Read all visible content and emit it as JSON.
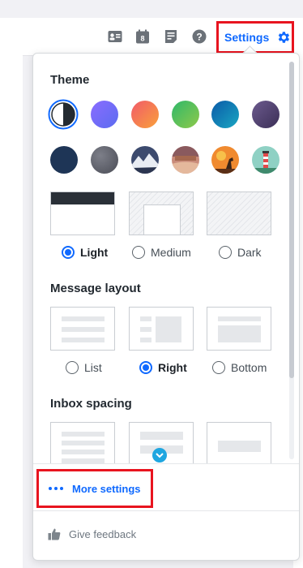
{
  "toolbar": {
    "icons": [
      "contacts-icon",
      "calendar-icon",
      "notepad-icon",
      "help-icon"
    ],
    "calendar_day": "8",
    "settings_label": "Settings"
  },
  "theme": {
    "title": "Theme",
    "options": [
      {
        "label": "Light",
        "checked": true
      },
      {
        "label": "Medium",
        "checked": false
      },
      {
        "label": "Dark",
        "checked": false
      }
    ]
  },
  "message_layout": {
    "title": "Message layout",
    "options": [
      {
        "label": "List",
        "checked": false
      },
      {
        "label": "Right",
        "checked": true
      },
      {
        "label": "Bottom",
        "checked": false
      }
    ]
  },
  "inbox_spacing": {
    "title": "Inbox spacing"
  },
  "footer": {
    "more_settings": "More settings",
    "give_feedback": "Give feedback"
  },
  "colors": {
    "accent": "#0f69ff",
    "highlight_box": "#e8141f"
  }
}
